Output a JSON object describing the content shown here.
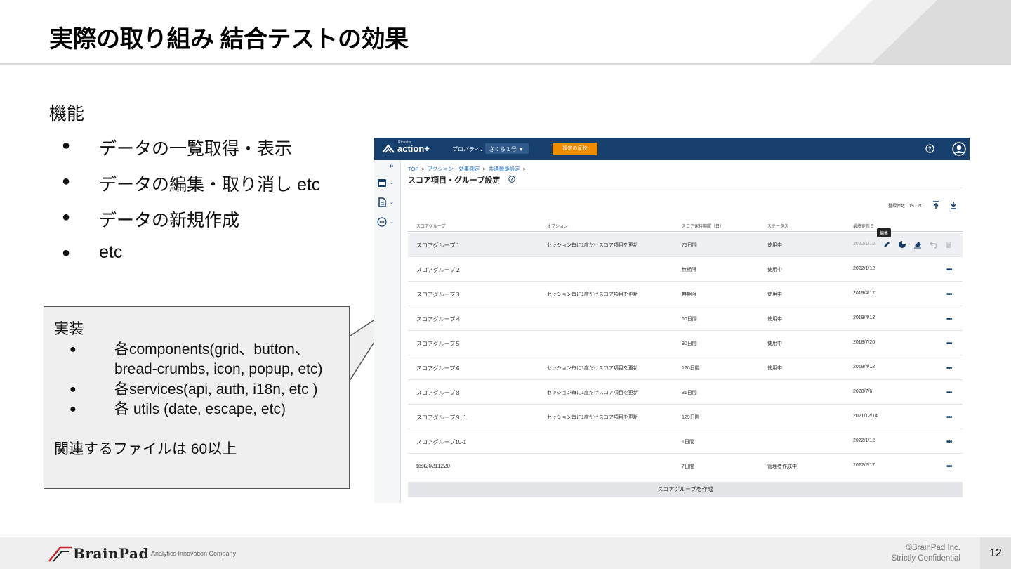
{
  "slide": {
    "title": "実際の取り組み 結合テストの効果",
    "feature_heading": "機能",
    "feature_items": [
      "データの一覧取得・表示",
      "データの編集・取り消し etc",
      "データの新規作成",
      "etc"
    ],
    "bullet_glyph": "●"
  },
  "callout": {
    "heading": "実装",
    "items": [
      "各components(grid、button、bread-crumbs, icon, popup, etc)",
      "各services(api, auth, i18n, etc )",
      "各 utils (date, escape, etc)"
    ],
    "footer": "関連するファイルは 60以上"
  },
  "app": {
    "logo_small": "Rtoaster",
    "logo_text": "action+",
    "property_label": "プロパティ：",
    "property_value": "さくら１号 ▼",
    "apply_button": "設定の反映",
    "sidebar_expand": "»",
    "breadcrumb": [
      "TOP",
      "アクション・効果測定",
      "共通機能設定"
    ],
    "breadcrumb_sep": ">",
    "page_title": "スコア項目・グループ設定",
    "count_label": "登録件数：15 / 21",
    "columns": [
      "スコアグループ",
      "オプション",
      "スコア保持期間（日）",
      "ステータス",
      "最終更新日"
    ],
    "rows": [
      {
        "name": "スコアグループ１",
        "option": "セッション毎に1度だけスコア項目を更新",
        "period": "75日間",
        "status": "使用中",
        "updated": "2022/1/12"
      },
      {
        "name": "スコアグループ２",
        "option": "",
        "period": "無期限",
        "status": "使用中",
        "updated": "2022/1/12"
      },
      {
        "name": "スコアグループ３",
        "option": "セッション毎に1度だけスコア項目を更新",
        "period": "無期限",
        "status": "使用中",
        "updated": "2019/4/12"
      },
      {
        "name": "スコアグループ４",
        "option": "",
        "period": "60日間",
        "status": "使用中",
        "updated": "2019/4/12"
      },
      {
        "name": "スコアグループ５",
        "option": "",
        "period": "90日間",
        "status": "使用中",
        "updated": "2018/7/20"
      },
      {
        "name": "スコアグループ６",
        "option": "セッション毎に1度だけスコア項目を更新",
        "period": "120日間",
        "status": "使用中",
        "updated": "2019/4/12"
      },
      {
        "name": "スコアグループ８",
        "option": "セッション毎に1度だけスコア項目を更新",
        "period": "31日間",
        "status": "",
        "updated": "2020/7/6"
      },
      {
        "name": "スコアグループ９.１",
        "option": "セッション毎に1度だけスコア項目を更新",
        "period": "129日間",
        "status": "",
        "updated": "2021/12/14"
      },
      {
        "name": "スコアグループ10-1",
        "option": "",
        "period": "1日間",
        "status": "",
        "updated": "2022/1/12"
      },
      {
        "name": "test20211220",
        "option": "",
        "period": "7日間",
        "status": "管理者作成中",
        "updated": "2022/2/17"
      }
    ],
    "more_glyph": "•••",
    "tooltip": "編集",
    "create_button": "スコアグループを作成"
  },
  "footer": {
    "brand": "BrainPad",
    "tagline": "Analytics Innovation Company",
    "copyright": "©BrainPad Inc.",
    "confidential": "Strictly Confidential",
    "page_number": "12"
  },
  "colors": {
    "app_header": "#173f6e",
    "apply_button": "#f08c00",
    "link": "#2a6fc5",
    "callout_bg": "#efefef"
  }
}
